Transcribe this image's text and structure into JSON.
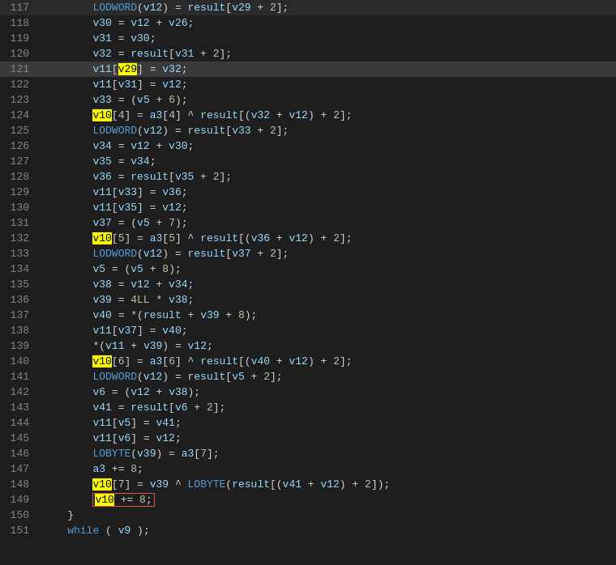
{
  "lines": [
    {
      "num": 117,
      "indent": 2,
      "highlighted": false,
      "content": "LODWORD(v12) = result[v29 + 2];"
    },
    {
      "num": 118,
      "indent": 2,
      "highlighted": false,
      "content": "v30 = v12 + v26;"
    },
    {
      "num": 119,
      "indent": 2,
      "highlighted": false,
      "content": "v31 = v30;"
    },
    {
      "num": 120,
      "indent": 2,
      "highlighted": false,
      "content": "v32 = result[v31 + 2];"
    },
    {
      "num": 121,
      "indent": 2,
      "highlighted": true,
      "content": "v11[v29] = v32;"
    },
    {
      "num": 122,
      "indent": 2,
      "highlighted": false,
      "content": "v11[v31] = v12;"
    },
    {
      "num": 123,
      "indent": 2,
      "highlighted": false,
      "content": "v33 = (v5 + 6);"
    },
    {
      "num": 124,
      "indent": 2,
      "highlighted": false,
      "content": "v10[4] = a3[4] ^ result[(v32 + v12) + 2];"
    },
    {
      "num": 125,
      "indent": 2,
      "highlighted": false,
      "content": "LODWORD(v12) = result[v33 + 2];"
    },
    {
      "num": 126,
      "indent": 2,
      "highlighted": false,
      "content": "v34 = v12 + v30;"
    },
    {
      "num": 127,
      "indent": 2,
      "highlighted": false,
      "content": "v35 = v34;"
    },
    {
      "num": 128,
      "indent": 2,
      "highlighted": false,
      "content": "v36 = result[v35 + 2];"
    },
    {
      "num": 129,
      "indent": 2,
      "highlighted": false,
      "content": "v11[v33] = v36;"
    },
    {
      "num": 130,
      "indent": 2,
      "highlighted": false,
      "content": "v11[v35] = v12;"
    },
    {
      "num": 131,
      "indent": 2,
      "highlighted": false,
      "content": "v37 = (v5 + 7);"
    },
    {
      "num": 132,
      "indent": 2,
      "highlighted": false,
      "content": "v10[5] = a3[5] ^ result[(v36 + v12) + 2];"
    },
    {
      "num": 133,
      "indent": 2,
      "highlighted": false,
      "content": "LODWORD(v12) = result[v37 + 2];"
    },
    {
      "num": 134,
      "indent": 2,
      "highlighted": false,
      "content": "v5 = (v5 + 8);"
    },
    {
      "num": 135,
      "indent": 2,
      "highlighted": false,
      "content": "v38 = v12 + v34;"
    },
    {
      "num": 136,
      "indent": 2,
      "highlighted": false,
      "content": "v39 = 4LL * v38;"
    },
    {
      "num": 137,
      "indent": 2,
      "highlighted": false,
      "content": "v40 = *(result + v39 + 8);"
    },
    {
      "num": 138,
      "indent": 2,
      "highlighted": false,
      "content": "v11[v37] = v40;"
    },
    {
      "num": 139,
      "indent": 2,
      "highlighted": false,
      "content": "*(v11 + v39) = v12;"
    },
    {
      "num": 140,
      "indent": 2,
      "highlighted": false,
      "content": "v10[6] = a3[6] ^ result[(v40 + v12) + 2];"
    },
    {
      "num": 141,
      "indent": 2,
      "highlighted": false,
      "content": "LODWORD(v12) = result[v5 + 2];"
    },
    {
      "num": 142,
      "indent": 2,
      "highlighted": false,
      "content": "v6 = (v12 + v38);"
    },
    {
      "num": 143,
      "indent": 2,
      "highlighted": false,
      "content": "v41 = result[v6 + 2];"
    },
    {
      "num": 144,
      "indent": 2,
      "highlighted": false,
      "content": "v11[v5] = v41;"
    },
    {
      "num": 145,
      "indent": 2,
      "highlighted": false,
      "content": "v11[v6] = v12;"
    },
    {
      "num": 146,
      "indent": 2,
      "highlighted": false,
      "content": "LOBYTE(v39) = a3[7];"
    },
    {
      "num": 147,
      "indent": 2,
      "highlighted": false,
      "content": "a3 += 8;"
    },
    {
      "num": 148,
      "indent": 2,
      "highlighted": false,
      "content": "v10[7] = v39 ^ LOBYTE(result[(v41 + v12) + 2]);"
    },
    {
      "num": 149,
      "indent": 2,
      "highlighted": false,
      "content": "v10 += 8;",
      "boxed": true
    },
    {
      "num": 150,
      "indent": 1,
      "highlighted": false,
      "content": "}"
    },
    {
      "num": 151,
      "indent": 1,
      "highlighted": false,
      "content": "while ( v9 );"
    }
  ],
  "colors": {
    "bg": "#1e1e1e",
    "linenum": "#858585",
    "keyword": "#569cd6",
    "function": "#dcdcaa",
    "variable": "#9cdcfe",
    "number": "#b5cea8",
    "text": "#d4d4d4",
    "highlighted_bg": "#3a3a3a",
    "yellow_hl": "#ffff00",
    "box_color": "#e05555"
  }
}
